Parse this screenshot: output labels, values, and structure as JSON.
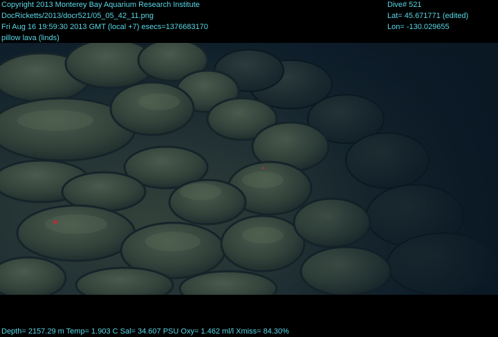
{
  "overlay": {
    "line1": "Copyright 2013 Monterey Bay Aquarium Research Institute",
    "line2": "DocRicketts/2013/docr521/05_05_42_11.png",
    "line3": "Fri Aug 16 19:59:30 2013 GMT (local +7)  esecs=1376683170",
    "line4": "pillow lava (linds)",
    "dive": "Dive# 521",
    "lat": "Lat= 45.671771 (edited)",
    "lon": "Lon= -130.029655",
    "footer": "Depth= 2157.29 m  Temp= 1.903 C  Sal= 34.607 PSU  Oxy= 1.462 ml/l  Xmiss= 84.30%"
  },
  "colors": {
    "overlay_text": "#5ad8e8",
    "water": "#0e1e2a",
    "rock": "#3a4a40"
  }
}
